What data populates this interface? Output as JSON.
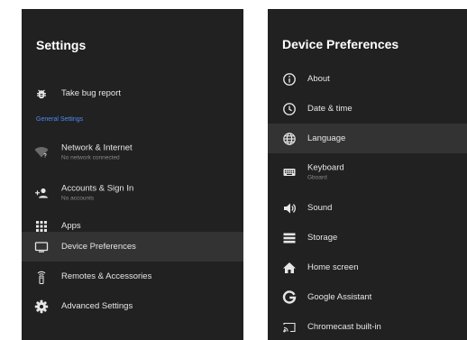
{
  "settings_panel": {
    "title": "Settings",
    "items": [
      {
        "label": "Take bug report",
        "icon": "bug-icon"
      },
      {
        "label": "Network & Internet",
        "sub": "No network connected",
        "icon": "wifi-off-icon"
      },
      {
        "label": "Accounts & Sign In",
        "sub": "No accounts",
        "icon": "add-person-icon"
      },
      {
        "label": "Apps",
        "icon": "apps-grid-icon"
      },
      {
        "label": "Device Preferences",
        "icon": "tv-icon",
        "selected": true
      },
      {
        "label": "Remotes & Accessories",
        "icon": "remote-icon"
      },
      {
        "label": "Advanced Settings",
        "icon": "gear-icon"
      }
    ],
    "section_header": "General Settings"
  },
  "device_preferences_panel": {
    "title": "Device Preferences",
    "items": [
      {
        "label": "About",
        "icon": "info-icon"
      },
      {
        "label": "Date & time",
        "icon": "clock-icon"
      },
      {
        "label": "Language",
        "icon": "globe-icon",
        "selected": true
      },
      {
        "label": "Keyboard",
        "sub": "Gboard",
        "icon": "keyboard-icon"
      },
      {
        "label": "Sound",
        "icon": "speaker-icon"
      },
      {
        "label": "Storage",
        "icon": "storage-icon"
      },
      {
        "label": "Home screen",
        "icon": "home-icon"
      },
      {
        "label": "Google Assistant",
        "icon": "google-icon"
      },
      {
        "label": "Chromecast built-in",
        "icon": "cast-icon"
      }
    ]
  },
  "colors": {
    "panel_background": "#212121",
    "selected_row": "#333333",
    "section_header": "#4c8df6",
    "page_background": "#ffffff"
  }
}
